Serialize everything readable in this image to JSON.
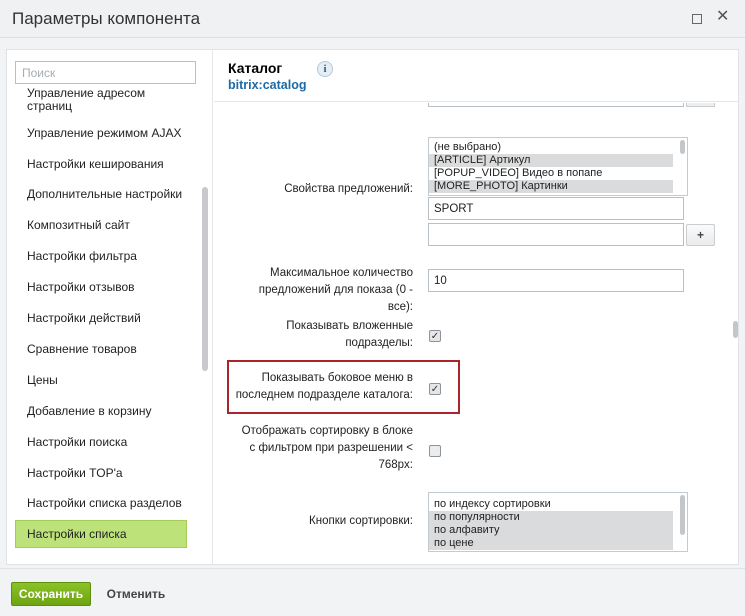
{
  "window": {
    "title": "Параметры компонента",
    "maximize_icon": "maximize-icon",
    "close_icon": "close-icon",
    "close_glyph": "✕"
  },
  "search": {
    "placeholder": "Поиск"
  },
  "sidebar": {
    "items": [
      {
        "label": "Управление адресом страниц"
      },
      {
        "label": "Управление режимом AJAX"
      },
      {
        "label": "Настройки кеширования"
      },
      {
        "label": "Дополнительные настройки"
      },
      {
        "label": "Композитный сайт"
      },
      {
        "label": "Настройки фильтра"
      },
      {
        "label": "Настройки отзывов"
      },
      {
        "label": "Настройки действий"
      },
      {
        "label": "Сравнение товаров"
      },
      {
        "label": "Цены"
      },
      {
        "label": "Добавление в корзину"
      },
      {
        "label": "Настройки поиска"
      },
      {
        "label": "Настройки TOP'а"
      },
      {
        "label": "Настройки списка разделов"
      },
      {
        "label": "Настройки списка"
      }
    ],
    "active_item": "Настройки списка"
  },
  "component": {
    "title": "Каталог",
    "code": "bitrix:catalog",
    "info_glyph": "i"
  },
  "form": {
    "offer_properties": {
      "label": "Свойства предложений:",
      "options": [
        {
          "label": "(не выбрано)",
          "selected": false
        },
        {
          "label": "[ARTICLE] Артикул",
          "selected": true
        },
        {
          "label": "[POPUP_VIDEO] Видео в попапе",
          "selected": false
        },
        {
          "label": "[MORE_PHOTO] Картинки",
          "selected": true
        }
      ],
      "extra_values": [
        "SPORT",
        ""
      ],
      "add_button": "+"
    },
    "max_offers": {
      "label": "Максимальное количество предложений для показа (0 - все):",
      "value": "10"
    },
    "show_subsections": {
      "label": "Показывать вложенные подразделы:",
      "checked": true
    },
    "show_side_menu": {
      "label": "Показывать боковое меню в последнем подразделе каталога:",
      "checked": true,
      "highlighted": true,
      "highlight_color": "#a9252a"
    },
    "show_sort_in_filter": {
      "label": "Отображать сортировку в блоке с фильтром при разрешении < 768px:",
      "checked": false
    },
    "sort_buttons": {
      "label": "Кнопки сортировки:",
      "options": [
        {
          "label": "по индексу сортировки",
          "selected": false
        },
        {
          "label": "по популярности",
          "selected": true
        },
        {
          "label": "по алфавиту",
          "selected": true
        },
        {
          "label": "по цене",
          "selected": true
        }
      ]
    },
    "check_glyph": "✓"
  },
  "footer": {
    "save_label": "Сохранить",
    "cancel_label": "Отменить"
  },
  "colors": {
    "save_button": "#7cb51a",
    "active_item": "#bde27a",
    "link": "#1e6aa5"
  }
}
